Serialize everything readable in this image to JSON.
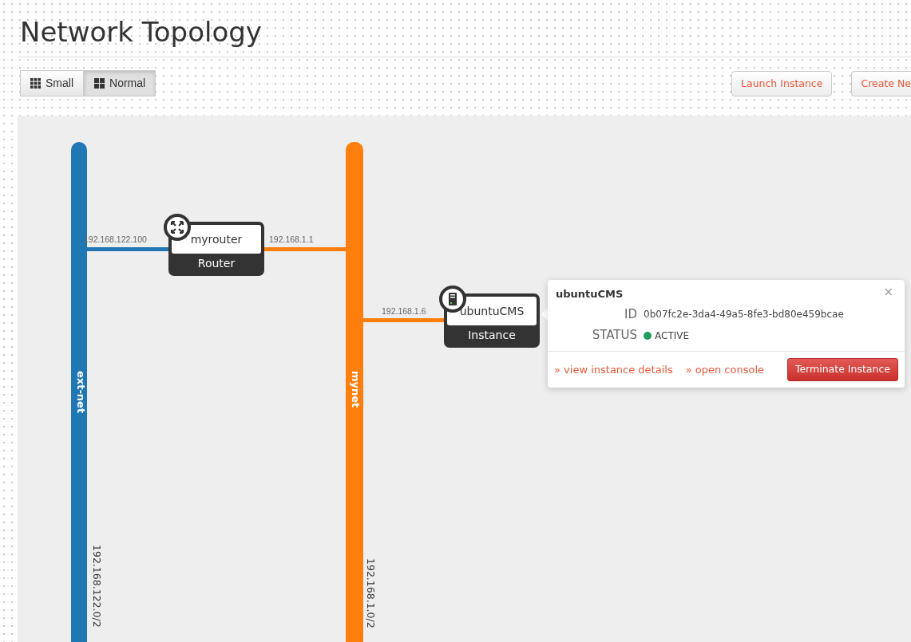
{
  "page_title": "Network Topology",
  "view_toggle": [
    {
      "label": "Small",
      "selected": false
    },
    {
      "label": "Normal",
      "selected": true
    }
  ],
  "actions": [
    "Launch Instance",
    "Create Ne"
  ],
  "networks": [
    {
      "name": "ext-net",
      "subnet": "192.168.122.0/2",
      "color": "#1f77b4"
    },
    {
      "name": "mynet",
      "subnet": "192.168.1.0/2",
      "color": "#ff7f0e"
    }
  ],
  "devices": [
    {
      "kind": "router",
      "name": "myrouter",
      "type_label": "Router",
      "ports": [
        "192.168.122.100",
        "192.168.1.1"
      ]
    },
    {
      "kind": "instance",
      "name": "ubuntuCMS",
      "type_label": "Instance",
      "ports": [
        "192.168.1.6"
      ]
    }
  ],
  "popover": {
    "title": "ubuntuCMS",
    "close": "×",
    "fields": [
      {
        "label": "ID",
        "value": "0b07fc2e-3da4-49a5-8fe3-bd80e459bcae"
      },
      {
        "label": "STATUS",
        "value": "ACTIVE",
        "kind": "status"
      }
    ],
    "links": [
      "» view instance details",
      "» open console"
    ],
    "button": "Terminate Instance"
  }
}
